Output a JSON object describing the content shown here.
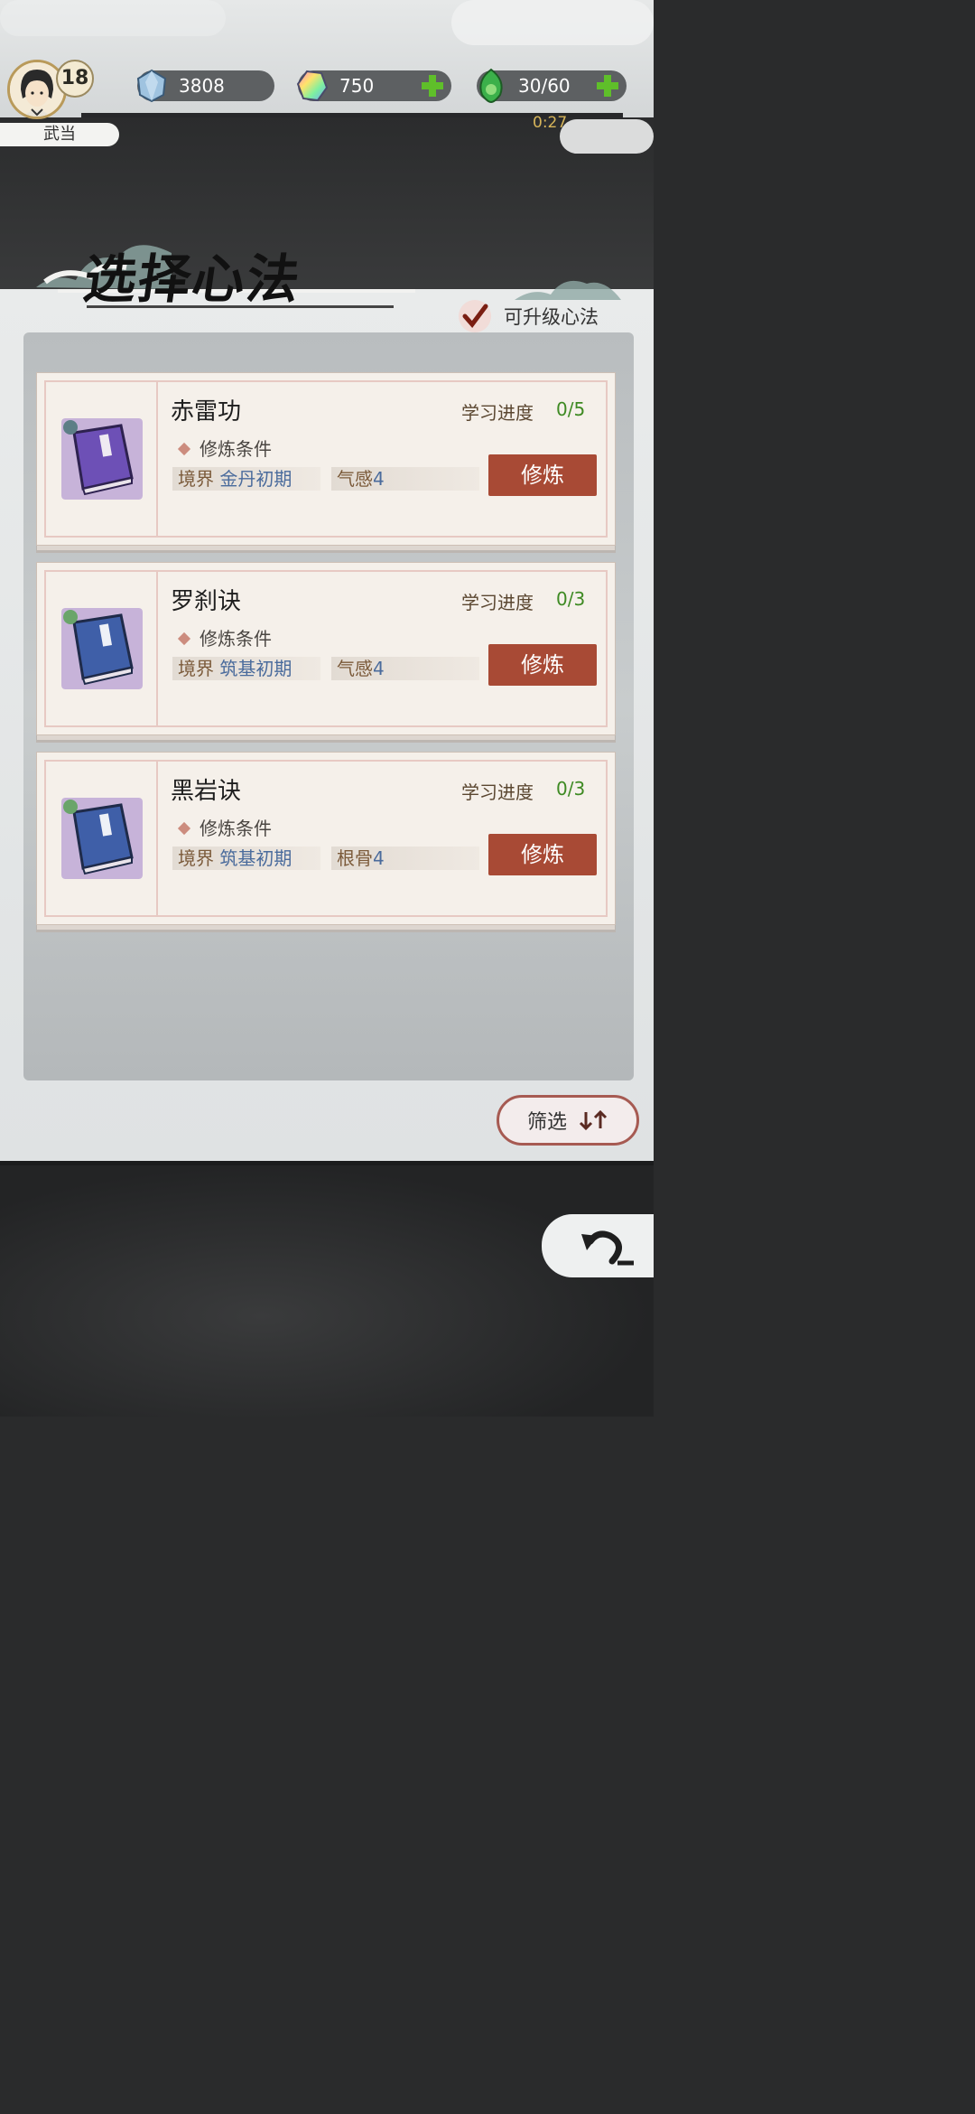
{
  "player": {
    "level": "18",
    "sect": "武当"
  },
  "resources": {
    "gem": "3808",
    "crystal": "750",
    "stamina": "30/60",
    "timer": "0:27"
  },
  "page": {
    "title": "选择心法",
    "upgradable_label": "可升级心法"
  },
  "cards": [
    {
      "name": "赤雷功",
      "progress_label": "学习进度",
      "progress": "0/5",
      "condition_label": "修炼条件",
      "req1_label": "境界",
      "req1_value": "金丹初期",
      "req2_label": "气感",
      "req2_value": "4",
      "button": "修炼"
    },
    {
      "name": "罗刹诀",
      "progress_label": "学习进度",
      "progress": "0/3",
      "condition_label": "修炼条件",
      "req1_label": "境界",
      "req1_value": "筑基初期",
      "req2_label": "气感",
      "req2_value": "4",
      "button": "修炼"
    },
    {
      "name": "黑岩诀",
      "progress_label": "学习进度",
      "progress": "0/3",
      "condition_label": "修炼条件",
      "req1_label": "境界",
      "req1_value": "筑基初期",
      "req2_label": "根骨",
      "req2_value": "4",
      "button": "修炼"
    }
  ],
  "filter": {
    "label": "筛选",
    "icon": "sort-arrows-icon"
  },
  "colors": {
    "train_button": "#a84a35",
    "progress_value": "#3e8a23",
    "timer": "#d7b55a"
  }
}
